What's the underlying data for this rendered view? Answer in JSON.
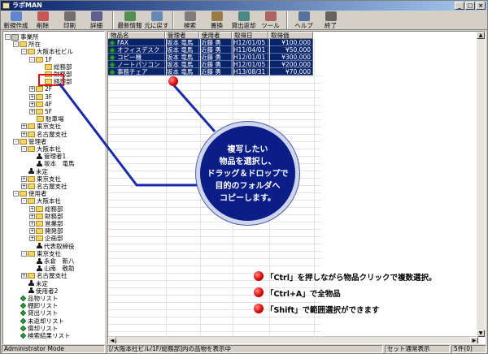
{
  "window": {
    "title": "ラボMAN",
    "controls": [
      "_",
      "□",
      "×"
    ]
  },
  "toolbar": {
    "buttons": [
      {
        "label": "新規作成",
        "icon": "new-icon"
      },
      {
        "label": "削除",
        "icon": "delete-icon"
      },
      {
        "label": "印刷",
        "icon": "print-icon"
      },
      {
        "label": "詳細",
        "icon": "detail-icon"
      },
      {
        "label": "最新情報",
        "icon": "refresh-icon"
      },
      {
        "label": "元に戻す",
        "icon": "undo-icon"
      },
      {
        "label": "検索",
        "icon": "search-icon"
      },
      {
        "label": "置換",
        "icon": "replace-icon"
      },
      {
        "label": "貸出返却",
        "icon": "lend-return-icon"
      },
      {
        "label": "ツール",
        "icon": "tool-icon"
      },
      {
        "label": "ヘルプ",
        "icon": "help-icon"
      },
      {
        "label": "終了",
        "icon": "exit-icon"
      }
    ]
  },
  "tree": {
    "nodes": [
      {
        "label": "事業所",
        "icon": "building",
        "box": "-"
      },
      {
        "label": "所在",
        "icon": "folder",
        "box": "-"
      },
      {
        "label": "大阪本社ビル",
        "icon": "folder",
        "box": "-"
      },
      {
        "label": "1F",
        "icon": "folder",
        "box": "-"
      },
      {
        "label": "総務部",
        "icon": "folder",
        "box": ""
      },
      {
        "label": "財務部",
        "icon": "folder",
        "box": ""
      },
      {
        "label": "経理部",
        "icon": "folder",
        "box": ""
      },
      {
        "label": "2F",
        "icon": "folder",
        "box": "+"
      },
      {
        "label": "3F",
        "icon": "folder",
        "box": "+"
      },
      {
        "label": "4F",
        "icon": "folder",
        "box": "+"
      },
      {
        "label": "5F",
        "icon": "folder",
        "box": "+"
      },
      {
        "label": "駐車場",
        "icon": "folder",
        "box": ""
      },
      {
        "label": "東京支社",
        "icon": "folder",
        "box": "+"
      },
      {
        "label": "名古屋支社",
        "icon": "folder",
        "box": "+"
      },
      {
        "label": "管理者",
        "icon": "folder",
        "box": "-"
      },
      {
        "label": "大阪本社",
        "icon": "folder",
        "box": "-"
      },
      {
        "label": "管理者1",
        "icon": "person",
        "box": ""
      },
      {
        "label": "坂本　竜馬",
        "icon": "person",
        "box": ""
      },
      {
        "label": "未定",
        "icon": "person",
        "box": ""
      },
      {
        "label": "東京支社",
        "icon": "folder",
        "box": "+"
      },
      {
        "label": "名古屋支社",
        "icon": "folder",
        "box": "+"
      },
      {
        "label": "使用者",
        "icon": "folder",
        "box": "-"
      },
      {
        "label": "大阪本社",
        "icon": "folder",
        "box": "-"
      },
      {
        "label": "総務部",
        "icon": "folder",
        "box": "+"
      },
      {
        "label": "財務部",
        "icon": "folder",
        "box": "+"
      },
      {
        "label": "営業部",
        "icon": "folder",
        "box": "+"
      },
      {
        "label": "開発部",
        "icon": "folder",
        "box": "+"
      },
      {
        "label": "企画部",
        "icon": "folder",
        "box": "+"
      },
      {
        "label": "代表取締役",
        "icon": "person",
        "box": ""
      },
      {
        "label": "東京支社",
        "icon": "folder",
        "box": "-"
      },
      {
        "label": "永倉　新八",
        "icon": "person",
        "box": ""
      },
      {
        "label": "山南　敬助",
        "icon": "person",
        "box": ""
      },
      {
        "label": "名古屋支社",
        "icon": "folder",
        "box": "+"
      },
      {
        "label": "未定",
        "icon": "person",
        "box": ""
      },
      {
        "label": "使用者2",
        "icon": "person",
        "box": ""
      },
      {
        "label": "品物リスト",
        "icon": "list",
        "box": ""
      },
      {
        "label": "棚卸リスト",
        "icon": "list",
        "box": ""
      },
      {
        "label": "貸出リスト",
        "icon": "list",
        "box": ""
      },
      {
        "label": "未返却リスト",
        "icon": "list",
        "box": ""
      },
      {
        "label": "償却リスト",
        "icon": "list",
        "box": ""
      },
      {
        "label": "検索結果リスト",
        "icon": "list",
        "box": ""
      }
    ]
  },
  "table": {
    "columns": [
      "物品名",
      "管理者",
      "使用者",
      "取得日",
      "取得価"
    ],
    "rows": [
      [
        "FAX",
        "坂本 竜馬",
        "近藤 勇",
        "H12/01/05",
        "¥100,000"
      ],
      [
        "オフィスデスク",
        "坂本 竜馬",
        "近藤 勇",
        "H11/04/01",
        "¥50,000"
      ],
      [
        "コピー機",
        "坂本 竜馬",
        "近藤 勇",
        "H12/01/01",
        "¥300,000"
      ],
      [
        "ノートパソコン",
        "坂本 竜馬",
        "近藤 勇",
        "H12/01/05",
        "¥200,000"
      ],
      [
        "事務チェア",
        "坂本 竜馬",
        "近藤 勇",
        "H13/08/31",
        "¥70,000"
      ]
    ]
  },
  "callout": {
    "lines": [
      "複写したい",
      "物品を選択し、",
      "ドラッグ＆ドロップで",
      "目的のフォルダへ",
      "コピーします。"
    ]
  },
  "notes": [
    "「Ctrl」を押しながら物品クリックで複数選択。",
    "「Ctrl+A」で全物品",
    "「Shift」で範囲選択ができます"
  ],
  "status": {
    "mode": "Administrator Mode",
    "path": "[/大阪本社ビル/1F/総務部]内の品物を表示中",
    "display": "セット通常表示",
    "count": "5件(0)"
  },
  "colors": {
    "selection": "#0a246a",
    "callout": "#0b1d86",
    "highlight": "#e01010"
  }
}
